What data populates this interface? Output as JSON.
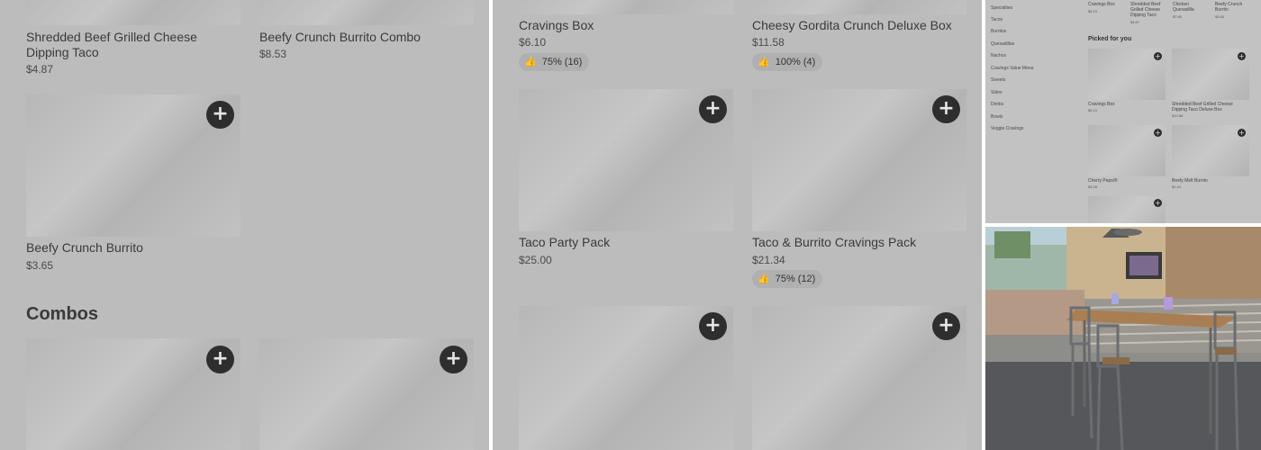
{
  "panel1": {
    "items_top": [
      {
        "name": "Shredded Beef Grilled Cheese Dipping Taco",
        "price": "$4.87"
      },
      {
        "name": "Beefy Crunch Burrito Combo",
        "price": "$8.53"
      }
    ],
    "item_mid": {
      "name": "Beefy Crunch Burrito",
      "price": "$3.65"
    },
    "section_title": "Combos"
  },
  "panel2": {
    "items_top": [
      {
        "name": "Cravings Box",
        "price": "$6.10",
        "rating": "75% (16)"
      },
      {
        "name": "Cheesy Gordita Crunch Deluxe Box",
        "price": "$11.58",
        "rating": "100% (4)"
      }
    ],
    "items_mid": [
      {
        "name": "Taco Party Pack",
        "price": "$25.00"
      },
      {
        "name": "Taco & Burrito Cravings Pack",
        "price": "$21.34",
        "rating": "75% (12)"
      }
    ]
  },
  "panel3": {
    "sidebar": [
      "Specialties",
      "Tacos",
      "Burritos",
      "Quesadillas",
      "Nachos",
      "Cravings Value Menu",
      "Sweets",
      "Sides",
      "Drinks",
      "Bowls",
      "Veggie Cravings"
    ],
    "top_row": [
      {
        "name": "Cravings Box",
        "price": "$6.10"
      },
      {
        "name": "Shredded Beef Grilled Cheese Dipping Taco",
        "price": "$4.87"
      },
      {
        "name": "Chicken Quesadilla",
        "price": "$7.65"
      },
      {
        "name": "Beefy Crunch Burrito",
        "price": "$3.65"
      }
    ],
    "picked_heading": "Picked for you",
    "picked": [
      {
        "name": "Cravings Box",
        "price": "$6.10"
      },
      {
        "name": "Shredded Beef Grilled Cheese Dipping Taco Deluxe Box",
        "price": "$10.58"
      },
      {
        "name": "Cherry Pepsi®",
        "price": "$3.28"
      },
      {
        "name": "Beefy Melt Burrito",
        "price": "$2.44"
      }
    ]
  },
  "add_symbol": "+",
  "like_symbol": "👍"
}
